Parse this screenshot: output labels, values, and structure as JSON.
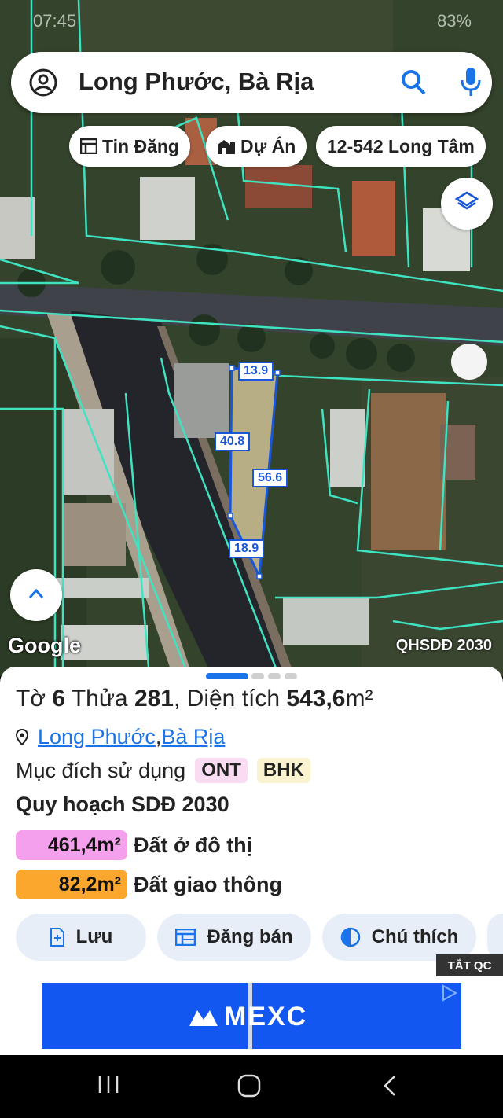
{
  "status_bar": {
    "time": "07:45",
    "battery": "83%"
  },
  "search": {
    "title": "Long Phước, Bà Rịa"
  },
  "chips": [
    {
      "label": "Tin Đăng",
      "icon": "listing-icon"
    },
    {
      "label": "Dự Án",
      "icon": "buildings-icon"
    },
    {
      "label": "12-542 Long Tâm",
      "icon": ""
    }
  ],
  "map": {
    "parcel_dims": [
      "13.9",
      "40.8",
      "56.6",
      "18.9"
    ],
    "attribution": "Google",
    "overlay": "QHSDĐ 2030",
    "colors": {
      "boundary": "#3fe3c2",
      "parcel": "#1a56d8"
    }
  },
  "sheet": {
    "title": {
      "prefix": "Tờ ",
      "sheet_no": "6",
      "mid": " Thửa ",
      "lot_no": "281",
      "area_label": ", Diện tích ",
      "area": "543,6",
      "unit": "m²"
    },
    "location": {
      "ward": "Long Phước",
      "sep": ", ",
      "city": "Bà Rịa"
    },
    "purpose_label": "Mục đích sử dụng",
    "purpose_tags": [
      "ONT",
      "BHK"
    ],
    "plan_title": "Quy hoạch SDĐ 2030",
    "zones": [
      {
        "area": "461,4m²",
        "label": "Đất ở đô thị",
        "color": "#f4a0ec"
      },
      {
        "area": "82,2m²",
        "label": "Đất giao thông",
        "color": "#fba72e"
      }
    ],
    "actions": [
      {
        "label": "Lưu",
        "icon": "save-icon"
      },
      {
        "label": "Đăng bán",
        "icon": "calendar-icon"
      },
      {
        "label": "Chú thích",
        "icon": "contrast-icon"
      }
    ],
    "ad_close": "TẮT QC",
    "ad_brand": "MEXC"
  }
}
